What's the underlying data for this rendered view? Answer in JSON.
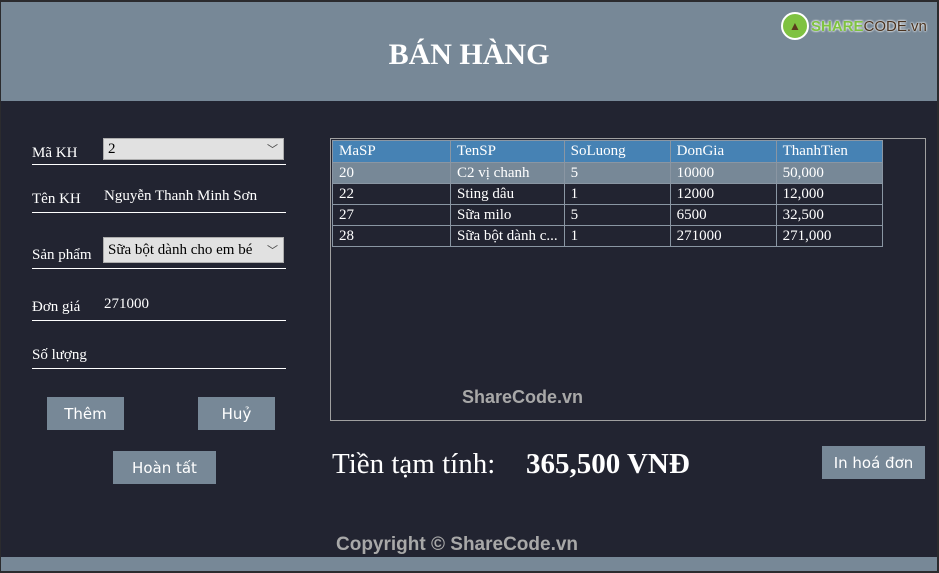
{
  "header": {
    "title": "BÁN HÀNG",
    "logo": {
      "prefix": "SHARE",
      "suffix": "CODE.vn"
    }
  },
  "form": {
    "customer_id": {
      "label": "Mã KH",
      "value": "2"
    },
    "customer_name": {
      "label": "Tên KH",
      "value": "Nguyễn Thanh Minh Sơn"
    },
    "product": {
      "label": "Sản phẩm",
      "value": "Sữa bột dành cho em bé"
    },
    "unit_price": {
      "label": "Đơn giá",
      "value": "271000"
    },
    "quantity": {
      "label": "Số lượng",
      "value": ""
    },
    "buttons": {
      "add": "Thêm",
      "cancel": "Huỷ",
      "finish": "Hoàn tất"
    }
  },
  "grid": {
    "columns": [
      "MaSP",
      "TenSP",
      "SoLuong",
      "DonGia",
      "ThanhTien"
    ],
    "rows": [
      [
        "20",
        "C2 vị chanh",
        "5",
        "10000",
        "50,000"
      ],
      [
        "22",
        "Sting dâu",
        "1",
        "12000",
        "12,000"
      ],
      [
        "27",
        "Sữa milo",
        "5",
        "6500",
        "32,500"
      ],
      [
        "28",
        "Sữa bột dành c...",
        "1",
        "271000",
        "271,000"
      ]
    ],
    "selected_row": 0
  },
  "watermark": "ShareCode.vn",
  "summary": {
    "label": "Tiền tạm tính:",
    "value": "365,500 VNĐ"
  },
  "print_button": "In hoá đơn",
  "copyright": "Copyright © ShareCode.vn"
}
